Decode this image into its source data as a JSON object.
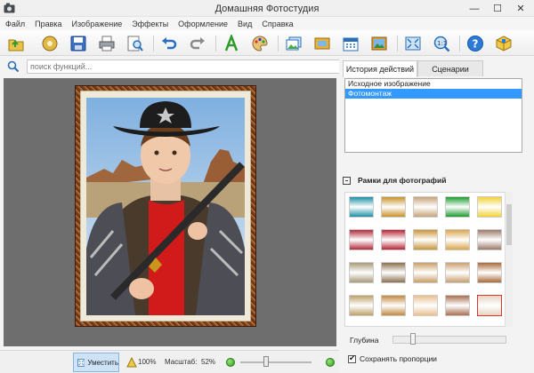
{
  "window": {
    "title": "Домашняя Фотостудия",
    "minimize": "—",
    "maximize": "☐",
    "close": "✕"
  },
  "menu": [
    "Файл",
    "Правка",
    "Изображение",
    "Эффекты",
    "Оформление",
    "Вид",
    "Справка"
  ],
  "toolbar_icons": [
    "open-icon",
    "effects-icon",
    "save-icon",
    "print-icon",
    "preview-icon",
    "undo-icon",
    "redo-icon",
    "text-icon",
    "palette-icon",
    "photo-icon",
    "frame-icon",
    "calendar-icon",
    "picture-icon",
    "fit-icon",
    "zoom-1-1-icon",
    "help-icon",
    "package-icon"
  ],
  "search": {
    "placeholder": "поиск функций..."
  },
  "tabs": [
    {
      "label": "История действий",
      "active": true
    },
    {
      "label": "Сценарии",
      "active": false
    }
  ],
  "history": [
    {
      "label": "Исходное изображение",
      "selected": false
    },
    {
      "label": "Фотомонтаж",
      "selected": true
    }
  ],
  "frames_section": {
    "title": "Рамки для фотографий"
  },
  "frame_swatches": [
    "#1f8fa6",
    "#c9922a",
    "#c8a37a",
    "#1d9b2f",
    "#f2d237",
    "#b02a3a",
    "#b72535",
    "#c8953a",
    "#d9a54a",
    "#9b7a6a",
    "#a89a7a",
    "#8a7050",
    "#c89f68",
    "#c8a070",
    "#a86a3a",
    "#bfa06a",
    "#c28a3e",
    "#e8c090",
    "#a87050",
    "#e4d6c2"
  ],
  "depth": {
    "label": "Глубина",
    "level": 0.15
  },
  "keep_proportions": {
    "label": "Сохранять пропорции",
    "checked": true
  },
  "bottom": {
    "fit_label": "Уместить",
    "zoom100_label": "100%",
    "scale_label": "Масштаб:",
    "scale_value": "52%",
    "zoom_level": 0.33
  },
  "colors": {
    "accent": "#3399ff",
    "canvas": "#6e6e6e"
  }
}
